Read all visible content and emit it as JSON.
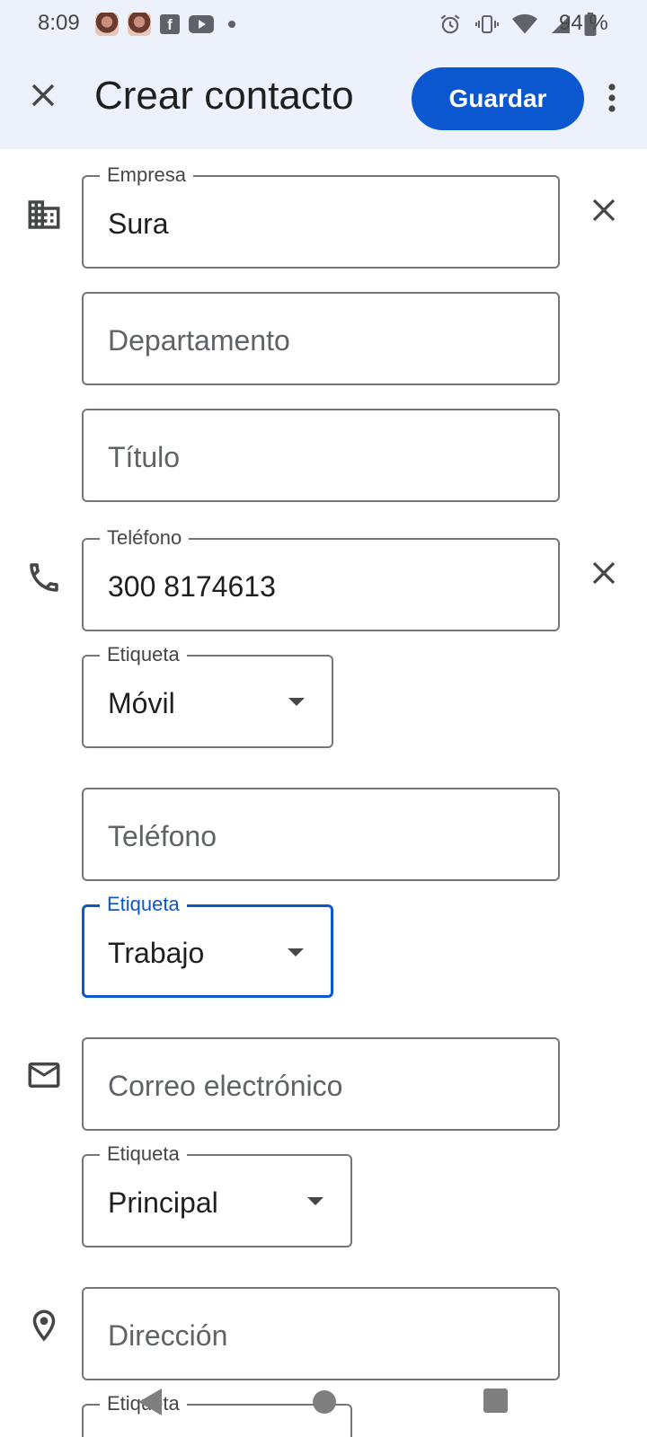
{
  "status_bar": {
    "time": "8:09",
    "battery": "94 %",
    "notification_icons": [
      "avatar-icon",
      "avatar-icon",
      "facebook-icon",
      "youtube-icon",
      "dot-icon"
    ],
    "system_icons": [
      "alarm-icon",
      "vibrate-icon",
      "wifi-icon",
      "signal-icon",
      "battery-icon"
    ]
  },
  "app_bar": {
    "title": "Crear contacto",
    "save_label": "Guardar",
    "close_icon": "close-icon",
    "more_icon": "more-vert-icon"
  },
  "fields": {
    "company": {
      "label": "Empresa",
      "value": "Sura"
    },
    "department": {
      "placeholder": "Departamento"
    },
    "title": {
      "placeholder": "Título"
    },
    "phone1": {
      "label": "Teléfono",
      "value": "300 8174613"
    },
    "phone1_label": {
      "label": "Etiqueta",
      "value": "Móvil"
    },
    "phone2": {
      "placeholder": "Teléfono"
    },
    "phone2_label": {
      "label": "Etiqueta",
      "value": "Trabajo"
    },
    "email": {
      "placeholder": "Correo electrónico"
    },
    "email_label": {
      "label": "Etiqueta",
      "value": "Principal"
    },
    "address": {
      "placeholder": "Dirección"
    },
    "address_label": {
      "label": "Etiqueta"
    }
  },
  "colors": {
    "accent": "#0b57d0",
    "app_bar_bg": "#ecf1fb",
    "outline": "#747775"
  }
}
